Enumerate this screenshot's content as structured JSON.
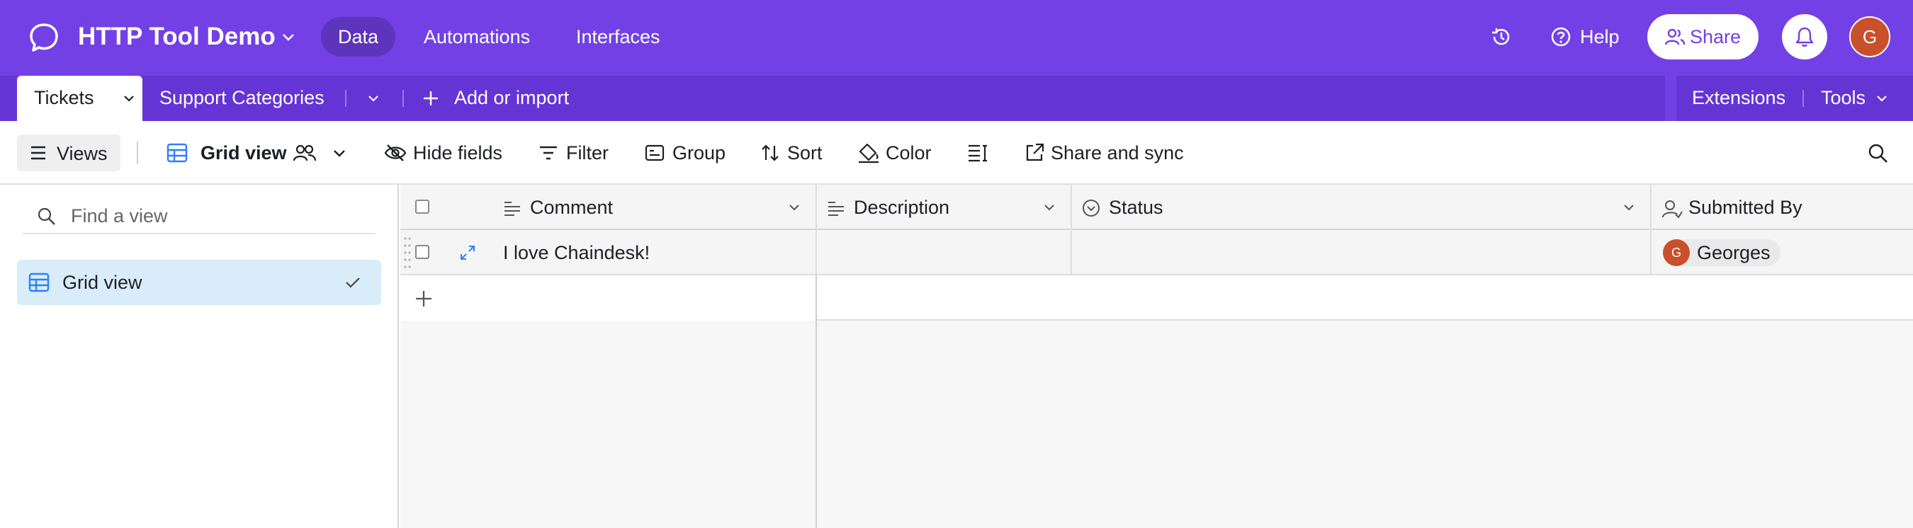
{
  "app": {
    "base_name": "HTTP Tool Demo",
    "nav": [
      "Data",
      "Automations",
      "Interfaces"
    ],
    "help_label": "Help",
    "share_label": "Share",
    "user_initial": "G"
  },
  "tables": {
    "active": "Tickets",
    "other": [
      "Support Categories"
    ],
    "add_label": "Add or import",
    "extensions_label": "Extensions",
    "tools_label": "Tools"
  },
  "toolbar": {
    "views_label": "Views",
    "current_view": "Grid view",
    "hide_fields": "Hide fields",
    "filter": "Filter",
    "group": "Group",
    "sort": "Sort",
    "color": "Color",
    "share_sync": "Share and sync"
  },
  "sidebar": {
    "search_placeholder": "Find a view",
    "views": [
      "Grid view"
    ]
  },
  "grid": {
    "columns": [
      "Comment",
      "Description",
      "Status",
      "Submitted By"
    ],
    "rows": [
      {
        "comment": "I love Chaindesk!",
        "description": "",
        "status": "",
        "submitted_by": {
          "name": "Georges",
          "initial": "G"
        }
      }
    ]
  },
  "colors": {
    "brand": "#7340e6",
    "avatar": "#c8502a",
    "selected_view_bg": "#d9ecf9"
  },
  "icons": [
    "chat-bubble-logo-icon",
    "chevron-down-icon",
    "history-icon",
    "help-circle-icon",
    "share-users-icon",
    "bell-icon",
    "plus-icon",
    "menu-icon",
    "grid-icon",
    "people-icon",
    "eye-slash-icon",
    "filter-icon",
    "group-icon",
    "sort-icon",
    "paint-bucket-icon",
    "row-height-icon",
    "external-link-icon",
    "search-icon",
    "check-icon",
    "long-text-icon",
    "status-icon",
    "user-icon",
    "expand-icon"
  ]
}
